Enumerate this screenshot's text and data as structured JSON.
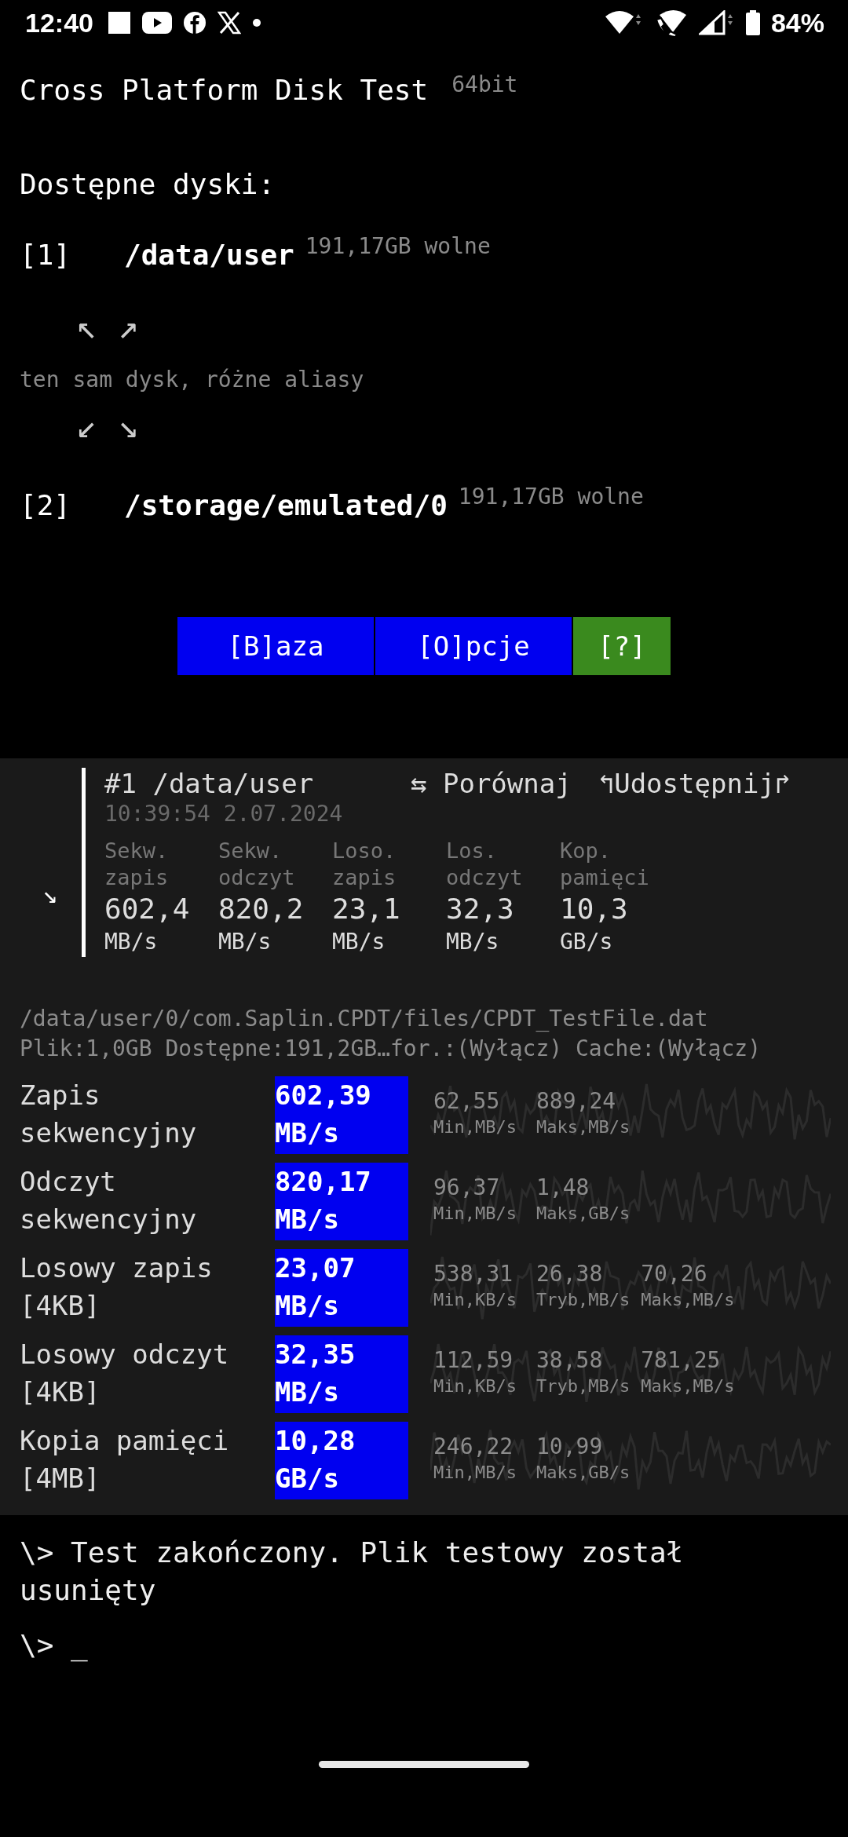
{
  "status_bar": {
    "time": "12:40",
    "battery": "84%"
  },
  "title": "Cross Platform Disk Test",
  "arch": "64bit",
  "drives_heading": "Dostępne dyski:",
  "drives": [
    {
      "index": "[1]",
      "path": "/data/user",
      "free": "191,17GB wolne"
    },
    {
      "index": "[2]",
      "path": "/storage/emulated/0",
      "free": "191,17GB wolne"
    }
  ],
  "alias_note": {
    "arrows_top": "↖ ↗",
    "text": "ten sam dysk, różne aliasy",
    "arrows_bottom": "↙ ↘"
  },
  "buttons": [
    {
      "label": "[B]aza",
      "kind": "primary"
    },
    {
      "label": "[O]pcje",
      "kind": "primary"
    },
    {
      "label": "[?]",
      "kind": "help"
    }
  ],
  "result_card": {
    "expand_arrow": "↘",
    "title": "#1 /data/user",
    "compare": "⇆ Porównaj",
    "share": "↰Udostępnij↱",
    "timestamp": "10:39:54 2.07.2024",
    "metrics": [
      {
        "label": "Sekw. zapis",
        "value": "602,4",
        "unit": "MB/s"
      },
      {
        "label": "Sekw. odczyt",
        "value": "820,2",
        "unit": "MB/s"
      },
      {
        "label": "Loso. zapis",
        "value": "23,1",
        "unit": "MB/s"
      },
      {
        "label": "Los. odczyt",
        "value": "32,3",
        "unit": "MB/s"
      },
      {
        "label": "Kop. pamięci",
        "value": "10,3",
        "unit": "GB/s"
      }
    ]
  },
  "file_path": "/data/user/0/com.Saplin.CPDT/files/CPDT_TestFile.dat",
  "file_info": "Plik:1,0GB Dostępne:191,2GB…for.:(Wyłącz) Cache:(Wyłącz)",
  "tests": [
    {
      "name": "Zapis sekwencyjny",
      "value": "602,39",
      "unit": "MB/s",
      "stats": [
        {
          "value": "62,55",
          "label": "Min,MB/s"
        },
        {
          "value": "889,24",
          "label": "Maks,MB/s"
        }
      ]
    },
    {
      "name": "Odczyt sekwencyjny",
      "value": "820,17",
      "unit": "MB/s",
      "stats": [
        {
          "value": "96,37",
          "label": "Min,MB/s"
        },
        {
          "value": "1,48",
          "label": "Maks,GB/s"
        }
      ]
    },
    {
      "name": "Losowy zapis [4KB]",
      "value": "23,07",
      "unit": "MB/s",
      "stats": [
        {
          "value": "538,31",
          "label": "Min,KB/s"
        },
        {
          "value": "26,38",
          "label": "Tryb,MB/s"
        },
        {
          "value": "70,26",
          "label": "Maks,MB/s"
        }
      ]
    },
    {
      "name": "Losowy odczyt [4KB]",
      "value": "32,35",
      "unit": "MB/s",
      "stats": [
        {
          "value": "112,59",
          "label": "Min,KB/s"
        },
        {
          "value": "38,58",
          "label": "Tryb,MB/s"
        },
        {
          "value": "781,25",
          "label": "Maks,MB/s"
        }
      ]
    },
    {
      "name": "Kopia pamięci [4MB]",
      "value": "10,28",
      "unit": "GB/s",
      "stats": [
        {
          "value": "246,22",
          "label": "Min,MB/s"
        },
        {
          "value": "10,99",
          "label": "Maks,GB/s"
        }
      ]
    }
  ],
  "console": [
    {
      "prompt": "\\>",
      "text": "Test zakończony. Plik testowy został usunięty"
    },
    {
      "prompt": "\\>",
      "text": "_"
    }
  ]
}
